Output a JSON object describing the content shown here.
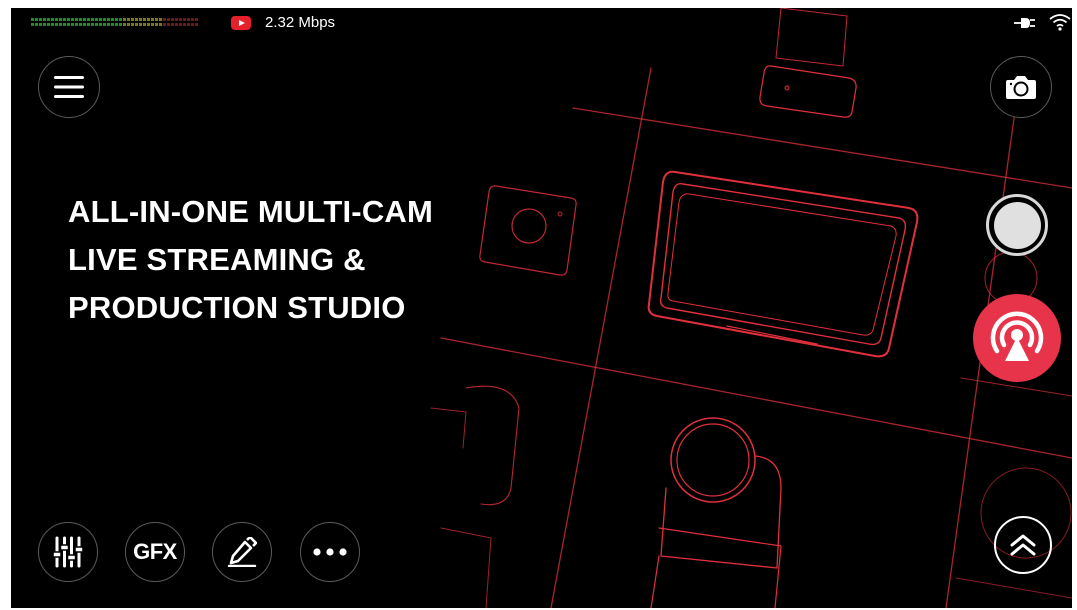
{
  "status_bar": {
    "audio_meter_icon": "audio-level-meter",
    "platform_icon": "youtube-icon",
    "bitrate": "2.32 Mbps",
    "power_icon": "plug-icon",
    "network_icon": "wifi-icon"
  },
  "headline": {
    "line1": "ALL-IN-ONE MULTI-CAM",
    "line2": "LIVE STREAMING &",
    "line3": "PRODUCTION STUDIO"
  },
  "buttons": {
    "menu": "hamburger-menu-icon",
    "snapshot": "camera-icon",
    "record": "record-icon",
    "go_live": "broadcast-icon",
    "mixer": "sliders-icon",
    "gfx": "GFX",
    "draw": "pen-icon",
    "more": "more-dots-icon",
    "collapse": "double-chevron-up-icon"
  },
  "colors": {
    "background": "#000000",
    "accent_red": "#e8344a",
    "line_red": "#e0303c",
    "meter_green": "#1f8a2e",
    "meter_yellow": "#7a7a1a",
    "meter_red": "#6a1a1a"
  }
}
